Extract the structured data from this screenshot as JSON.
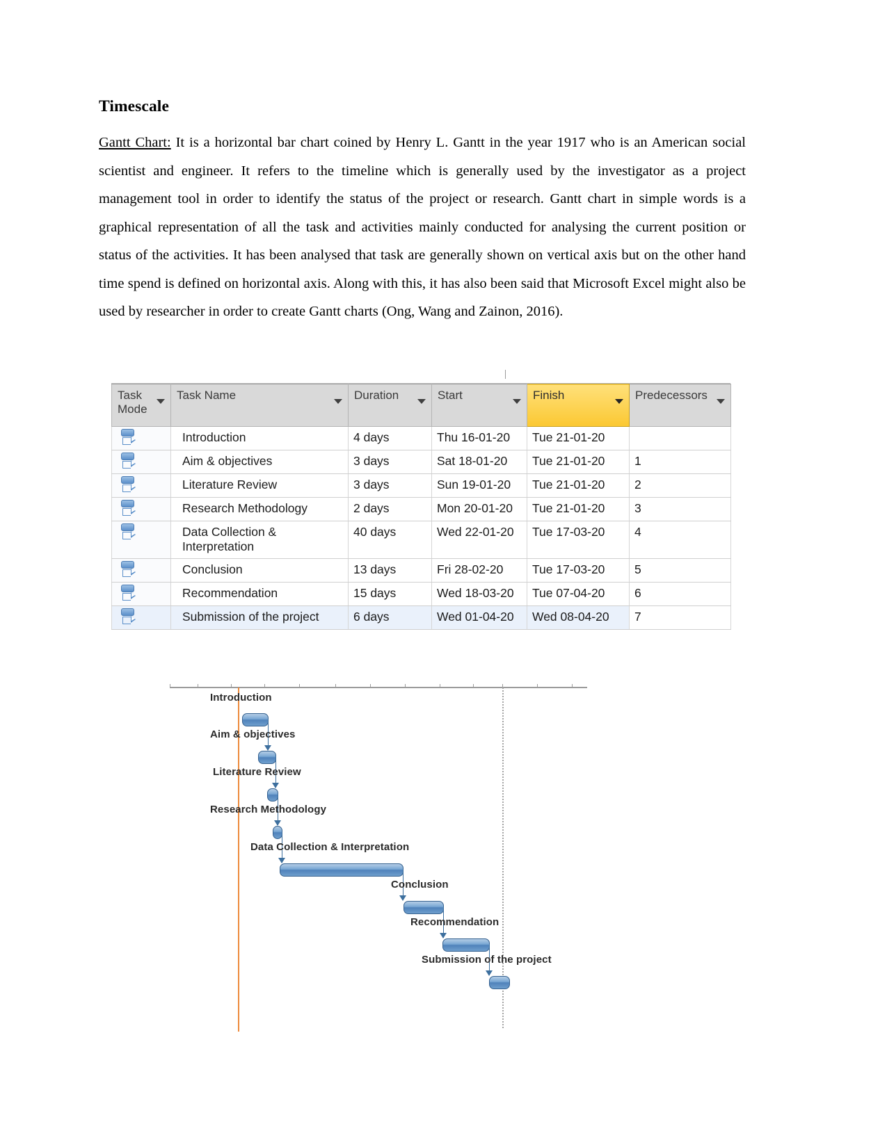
{
  "document": {
    "heading": "Timescale",
    "paragraph_lead": "Gantt Chart:",
    "paragraph_body": " It is a horizontal bar chart coined by Henry L. Gantt in the year 1917 who is an American social scientist and engineer. It refers to the timeline which is generally used by the investigator as a project management tool in order to identify the status of the project or research. Gantt chart in simple words is a graphical representation of all the task and activities mainly conducted for analysing the current position or status of the activities. It has been analysed that task are generally shown on vertical axis but on the other hand time spend is defined on horizontal axis. Along with this, it has also been said that Microsoft Excel might also be used by researcher in order to create Gantt charts (Ong, Wang and Zainon, 2016)."
  },
  "table": {
    "headers": [
      "Task Mode",
      "Task Name",
      "Duration",
      "Start",
      "Finish",
      "Predecessors"
    ],
    "highlighted_header": "Finish",
    "highlight_color": "#fbc832",
    "mode_icon": "auto-schedule-icon",
    "filter_icon": "filter-dropdown-icon",
    "rows": [
      {
        "name": "Introduction",
        "duration": "4 days",
        "start": "Thu 16-01-20",
        "finish": "Tue 21-01-20",
        "predecessors": ""
      },
      {
        "name": "Aim & objectives",
        "duration": "3 days",
        "start": "Sat 18-01-20",
        "finish": "Tue 21-01-20",
        "predecessors": "1"
      },
      {
        "name": "Literature Review",
        "duration": "3 days",
        "start": "Sun 19-01-20",
        "finish": "Tue 21-01-20",
        "predecessors": "2"
      },
      {
        "name": "Research Methodology",
        "duration": "2 days",
        "start": "Mon 20-01-20",
        "finish": "Tue 21-01-20",
        "predecessors": "3"
      },
      {
        "name": "Data Collection & Interpretation",
        "duration": "40 days",
        "start": "Wed 22-01-20",
        "finish": "Tue 17-03-20",
        "predecessors": "4"
      },
      {
        "name": "Conclusion",
        "duration": "13 days",
        "start": "Fri 28-02-20",
        "finish": "Tue 17-03-20",
        "predecessors": "5"
      },
      {
        "name": "Recommendation",
        "duration": "15 days",
        "start": "Wed 18-03-20",
        "finish": "Tue 07-04-20",
        "predecessors": "6"
      },
      {
        "name": "Submission of the project",
        "duration": "6 days",
        "start": "Wed 01-04-20",
        "finish": "Wed 08-04-20",
        "predecessors": "7"
      }
    ]
  },
  "chart_data": {
    "type": "bar",
    "title": "",
    "xlabel": "",
    "ylabel": "",
    "orientation": "horizontal",
    "grid": false,
    "legend": "none",
    "bar_color": "#4f82bb",
    "today_marker_color": "#ed8b3c",
    "status_marker_color": "#a5a5a5",
    "categories": [
      "Introduction",
      "Aim & objectives",
      "Literature Review",
      "Research Methodology",
      "Data Collection & Interpretation",
      "Conclusion",
      "Recommendation",
      "Submission of the project"
    ],
    "tasks": [
      {
        "label": "Introduction",
        "duration_days": 4,
        "start": "Thu 16-01-20",
        "finish": "Tue 21-01-20",
        "bar_left_pct": 17.5,
        "bar_width_pct": 6.5,
        "row": 0
      },
      {
        "label": "Aim & objectives",
        "duration_days": 3,
        "start": "Sat 18-01-20",
        "finish": "Tue 21-01-20",
        "bar_left_pct": 21.0,
        "bar_width_pct": 4.5,
        "row": 1
      },
      {
        "label": "Literature Review",
        "duration_days": 3,
        "start": "Sun 19-01-20",
        "finish": "Tue 21-01-20",
        "bar_left_pct": 23.2,
        "bar_width_pct": 3.0,
        "row": 2
      },
      {
        "label": "Research Methodology",
        "duration_days": 2,
        "start": "Mon 20-01-20",
        "finish": "Tue 21-01-20",
        "bar_left_pct": 25.3,
        "bar_width_pct": 3.0,
        "row": 3
      },
      {
        "label": "Data Collection & Interpretation",
        "duration_days": 40,
        "start": "Wed 22-01-20",
        "finish": "Tue 17-03-20",
        "bar_left_pct": 27.5,
        "bar_width_pct": 29.5,
        "row": 4
      },
      {
        "label": "Conclusion",
        "duration_days": 13,
        "start": "Fri 28-02-20",
        "finish": "Tue 17-03-20",
        "bar_left_pct": 57.0,
        "bar_width_pct": 9.5,
        "row": 5
      },
      {
        "label": "Recommendation",
        "duration_days": 15,
        "start": "Wed 18-03-20",
        "finish": "Tue 07-04-20",
        "bar_left_pct": 66.0,
        "bar_width_pct": 11.5,
        "row": 6
      },
      {
        "label": "Submission of the project",
        "duration_days": 6,
        "start": "Wed 01-04-20",
        "finish": "Wed 08-04-20",
        "bar_left_pct": 77.2,
        "bar_width_pct": 5.0,
        "row": 7
      }
    ],
    "dependencies": [
      {
        "from": "Introduction",
        "to": "Aim & objectives"
      },
      {
        "from": "Aim & objectives",
        "to": "Literature Review"
      },
      {
        "from": "Literature Review",
        "to": "Research Methodology"
      },
      {
        "from": "Research Methodology",
        "to": "Data Collection & Interpretation"
      },
      {
        "from": "Data Collection & Interpretation",
        "to": "Conclusion"
      },
      {
        "from": "Conclusion",
        "to": "Recommendation"
      },
      {
        "from": "Recommendation",
        "to": "Submission of the project"
      }
    ]
  }
}
